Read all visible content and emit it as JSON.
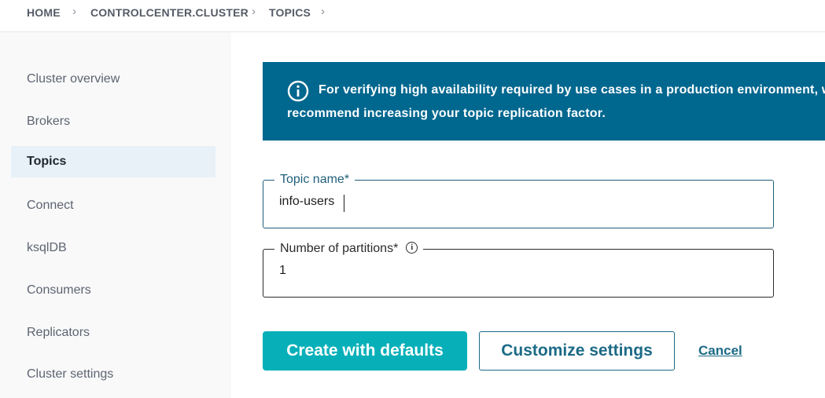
{
  "breadcrumb": {
    "items": [
      "HOME",
      "CONTROLCENTER.CLUSTER",
      "TOPICS"
    ]
  },
  "sidebar": {
    "items": [
      {
        "label": "Cluster overview"
      },
      {
        "label": "Brokers"
      },
      {
        "label": "Topics",
        "active": true
      },
      {
        "label": "Connect"
      },
      {
        "label": "ksqlDB"
      },
      {
        "label": "Consumers"
      },
      {
        "label": "Replicators"
      },
      {
        "label": "Cluster settings"
      }
    ]
  },
  "banner": {
    "icon": "info-circle-icon",
    "text": "For verifying high availability required by use cases in a production environment, we recommend increasing your topic replication factor."
  },
  "form": {
    "topic_name": {
      "label": "Topic name*",
      "value": "info-users"
    },
    "partitions": {
      "label": "Number of partitions*",
      "value": "1",
      "icon": "info-icon"
    }
  },
  "actions": {
    "create": "Create with defaults",
    "customize": "Customize settings",
    "cancel": "Cancel"
  },
  "colors": {
    "banner_bg": "#00678f",
    "primary_button": "#07b0b9",
    "secondary_text": "#1c6a86",
    "sidebar_active_bg": "#e8f1f8"
  }
}
